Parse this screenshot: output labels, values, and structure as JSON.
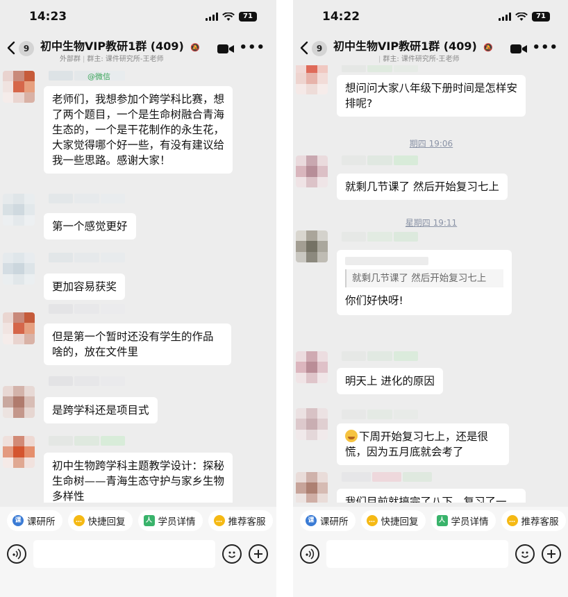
{
  "left": {
    "status_time": "14:23",
    "battery": "71",
    "group_title": "初中生物VIP教研1群",
    "member_count": "(409)",
    "unread_badge": "9",
    "external_tag": "外部群",
    "group_owner": "群主: 课件研究所-王老师",
    "wechat_tag": "@微信",
    "messages": [
      "老师们，我想参加个跨学科比赛，想了两个题目，一个是生命树融合青海生态的，一个是干花制作的永生花，大家觉得哪个好一些，有没有建议给我一些思路。感谢大家！",
      "第一个感觉更好",
      "更加容易获奖",
      "但是第一个暂时还没有学生的作品啥的，放在文件里",
      "是跨学科还是项目式",
      "初中生物跨学科主题教学设计：探秘生命树——青海生态守护与家乡生物多样性"
    ]
  },
  "right": {
    "status_time": "14:22",
    "battery": "71",
    "group_title": "初中生物VIP教研1群",
    "member_count": "(409)",
    "unread_badge": "9",
    "group_owner": "群主: 课件研究所-王老师",
    "timestamps": [
      "期四 19:06",
      "星期四 19:11"
    ],
    "messages": [
      "想问问大家八年级下册时间是怎样安排呢?",
      "就剩几节课了  然后开始复习七上",
      "你们好快呀!",
      "明天上 进化的原因",
      "下周开始复习七上，还是很慌，因为五月底就会考了",
      "我们目前就搞完了八下，复习了一"
    ],
    "quoted": "就剩几节课了  然后开始复习七上"
  },
  "quick_replies": [
    {
      "label": "课研所",
      "icon": "course-icon"
    },
    {
      "label": "快捷回复",
      "icon": "quick-reply-icon"
    },
    {
      "label": "学员详情",
      "icon": "student-icon"
    },
    {
      "label": "推荐客服",
      "icon": "service-icon"
    }
  ],
  "colors": {
    "chat_bg": "#ededed",
    "bubble": "#ffffff",
    "wechat_green": "#3aa55a",
    "timestamp": "#8a93a6"
  }
}
